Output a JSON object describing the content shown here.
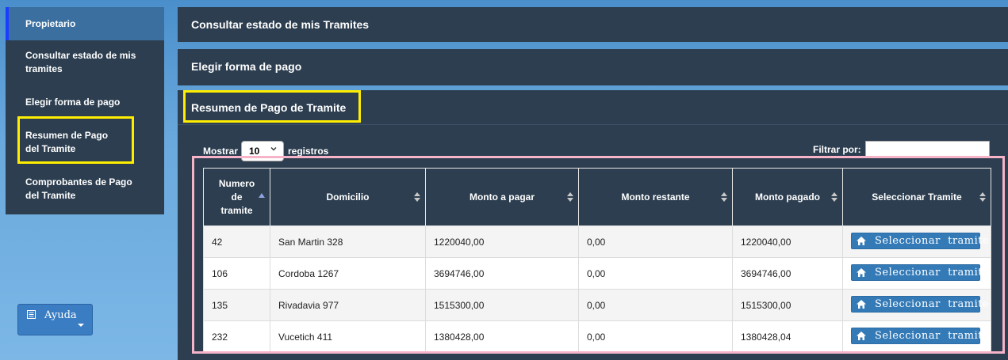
{
  "sidebar": {
    "items": [
      {
        "label": "Propietario"
      },
      {
        "label": "Consultar estado de mis tramites"
      },
      {
        "label": "Elegir forma de pago"
      },
      {
        "label": "Resumen de Pago del Tramite"
      },
      {
        "label": "Comprobantes de Pago del Tramite"
      }
    ]
  },
  "help": {
    "label": "Ayuda"
  },
  "panels": [
    {
      "title": "Consultar estado de mis Tramites"
    },
    {
      "title": "Elegir forma de pago"
    },
    {
      "title": "Resumen de Pago de Tramite"
    }
  ],
  "table_controls": {
    "show_label": "Mostrar",
    "page_size": "10",
    "records_label": "registros",
    "filter_label": "Filtrar por:",
    "filter_value": ""
  },
  "table": {
    "columns": [
      {
        "label": "Numero de tramite",
        "sort": "asc"
      },
      {
        "label": "Domicilio",
        "sort": "both"
      },
      {
        "label": "Monto a pagar",
        "sort": "both"
      },
      {
        "label": "Monto restante",
        "sort": "both"
      },
      {
        "label": "Monto pagado",
        "sort": "both"
      },
      {
        "label": "Seleccionar Tramite",
        "sort": "both"
      }
    ],
    "rows": [
      {
        "numero": "42",
        "domicilio": "San Martin 328",
        "a_pagar": "1220040,00",
        "restante": "0,00",
        "pagado": "1220040,00",
        "action": "Seleccionar  tramite"
      },
      {
        "numero": "106",
        "domicilio": "Cordoba 1267",
        "a_pagar": "3694746,00",
        "restante": "0,00",
        "pagado": "3694746,00",
        "action": "Seleccionar  tramite"
      },
      {
        "numero": "135",
        "domicilio": "Rivadavia 977",
        "a_pagar": "1515300,00",
        "restante": "0,00",
        "pagado": "1515300,00",
        "action": "Seleccionar  tramite"
      },
      {
        "numero": "232",
        "domicilio": "Vucetich 411",
        "a_pagar": "1380428,00",
        "restante": "0,00",
        "pagado": "1380428,04",
        "action": "Seleccionar  tramite"
      }
    ]
  },
  "colors": {
    "panel_bg": "#2c3e50",
    "sidebar_active": "#3a6f9f",
    "button_blue": "#337ab7",
    "highlight_yellow": "#ffee00",
    "highlight_pink": "#f7b3c8"
  },
  "icons": {
    "help": "book-icon",
    "select_button": "home-icon",
    "page_size": "chevron-down-icon",
    "sort": "sort-icon"
  }
}
